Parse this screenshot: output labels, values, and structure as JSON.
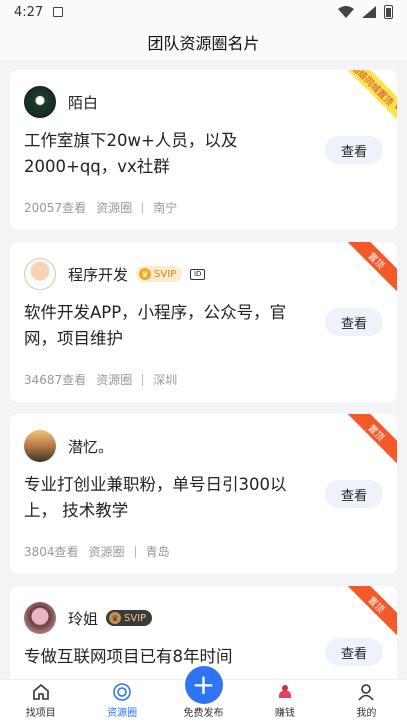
{
  "status": {
    "time": "4:27"
  },
  "header": {
    "title": "团队资源圈名片"
  },
  "view_label": "查看",
  "cards": [
    {
      "name": "陌白",
      "ribbon": "超级同城置顶",
      "desc": "工作室旗下20w+人员，以及2000+qq，vx社群",
      "views": "20057查看",
      "category": "资源圈",
      "city": "南宁"
    },
    {
      "name": "程序开发",
      "badge": "SVIP",
      "ribbon": "置顶",
      "desc": "软件开发APP，小程序，公众号，官网，项目维护",
      "views": "34687查看",
      "category": "资源圈",
      "city": "深圳"
    },
    {
      "name": "潜忆。",
      "ribbon": "置顶",
      "desc": "专业打创业兼职粉，单号日引300以上， 技术教学",
      "views": "3804查看",
      "category": "资源圈",
      "city": "青岛"
    },
    {
      "name": "玲姐",
      "badge": "SVIP",
      "ribbon": "置顶",
      "desc": "专做互联网项目已有8年时间"
    }
  ],
  "tabbar": {
    "items": [
      {
        "label": "找项目",
        "icon": "home-icon"
      },
      {
        "label": "资源圈",
        "icon": "resource-circle-icon",
        "active": true
      },
      {
        "label": "免费发布",
        "icon": "plus-icon"
      },
      {
        "label": "赚钱",
        "icon": "money-icon"
      },
      {
        "label": "我的",
        "icon": "user-icon"
      }
    ]
  },
  "colors": {
    "accent": "#2f74f5",
    "ribbon_top": "#f25a2b",
    "ribbon_super": "#ffe24a"
  }
}
